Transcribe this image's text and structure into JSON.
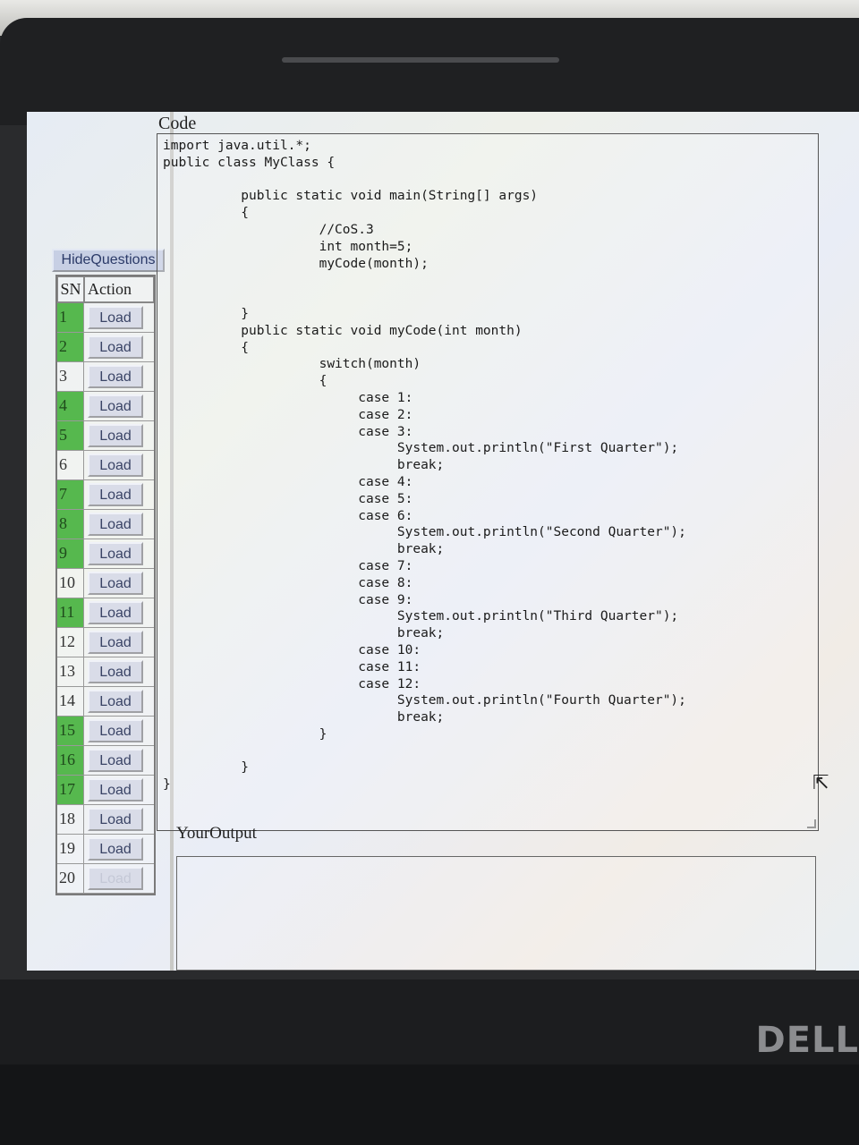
{
  "sidebar": {
    "hide_label": "HideQuestions",
    "header_sn": "SN",
    "header_action": "Action",
    "rows": [
      {
        "sn": "1",
        "action": "Load"
      },
      {
        "sn": "2",
        "action": "Load"
      },
      {
        "sn": "3",
        "action": "Load"
      },
      {
        "sn": "4",
        "action": "Load"
      },
      {
        "sn": "5",
        "action": "Load"
      },
      {
        "sn": "6",
        "action": "Load"
      },
      {
        "sn": "7",
        "action": "Load"
      },
      {
        "sn": "8",
        "action": "Load"
      },
      {
        "sn": "9",
        "action": "Load"
      },
      {
        "sn": "10",
        "action": "Load"
      },
      {
        "sn": "11",
        "action": "Load"
      },
      {
        "sn": "12",
        "action": "Load"
      },
      {
        "sn": "13",
        "action": "Load"
      },
      {
        "sn": "14",
        "action": "Load"
      },
      {
        "sn": "15",
        "action": "Load"
      },
      {
        "sn": "16",
        "action": "Load"
      },
      {
        "sn": "17",
        "action": "Load"
      },
      {
        "sn": "18",
        "action": "Load"
      },
      {
        "sn": "19",
        "action": "Load"
      },
      {
        "sn": "20",
        "action": "Load"
      }
    ]
  },
  "code": {
    "label": "Code",
    "content": "import java.util.*;\npublic class MyClass {\n\n          public static void main(String[] args)\n          {\n                    //CoS.3\n                    int month=5;\n                    myCode(month);\n\n\n          }\n          public static void myCode(int month)\n          {\n                    switch(month)\n                    {\n                         case 1:\n                         case 2:\n                         case 3:\n                              System.out.println(\"First Quarter\");\n                              break;\n                         case 4:\n                         case 5:\n                         case 6:\n                              System.out.println(\"Second Quarter\");\n                              break;\n                         case 7:\n                         case 8:\n                         case 9:\n                              System.out.println(\"Third Quarter\");\n                              break;\n                         case 10:\n                         case 11:\n                         case 12:\n                              System.out.println(\"Fourth Quarter\");\n                              break;\n                    }\n\n          }\n}"
  },
  "output": {
    "label": "YourOutput",
    "value": ""
  },
  "device": {
    "logo": "DELL"
  }
}
